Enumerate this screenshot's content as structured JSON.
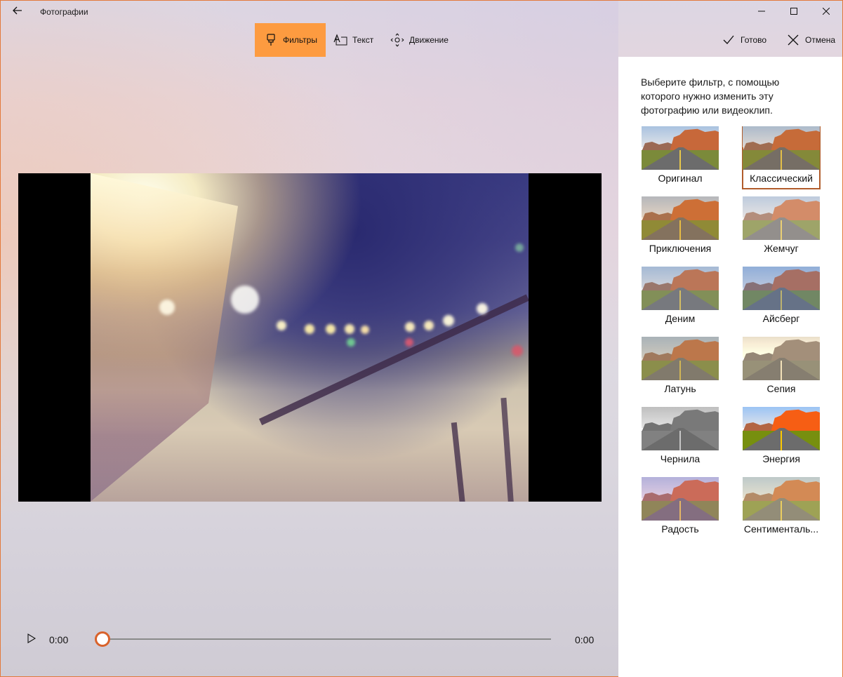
{
  "window": {
    "title": "Фотографии",
    "accent_color": "#fd9b40",
    "selection_color": "#b15c2b"
  },
  "toolbar": {
    "filters_label": "Фильтры",
    "text_label": "Текст",
    "motion_label": "Движение",
    "done_label": "Готово",
    "cancel_label": "Отмена"
  },
  "playback": {
    "current_time": "0:00",
    "end_time": "0:00",
    "progress": 0
  },
  "panel": {
    "description": "Выберите фильтр, с помощью которого нужно изменить эту фотографию или видеоклип.",
    "selected": "Классический",
    "filters": [
      {
        "label": "Оригинал"
      },
      {
        "label": "Классический"
      },
      {
        "label": "Приключения"
      },
      {
        "label": "Жемчуг"
      },
      {
        "label": "Деним"
      },
      {
        "label": "Айсберг"
      },
      {
        "label": "Латунь"
      },
      {
        "label": "Сепия"
      },
      {
        "label": "Чернила"
      },
      {
        "label": "Энергия"
      },
      {
        "label": "Радость"
      },
      {
        "label": "Сентименталь..."
      }
    ]
  },
  "icons": {
    "back": "back-arrow-icon",
    "minimize": "minimize-icon",
    "maximize": "maximize-icon",
    "close": "close-icon",
    "filters": "brush-icon",
    "text": "text-icon",
    "motion": "motion-icon",
    "done": "checkmark-icon",
    "cancel": "cancel-x-icon",
    "play": "play-icon"
  }
}
